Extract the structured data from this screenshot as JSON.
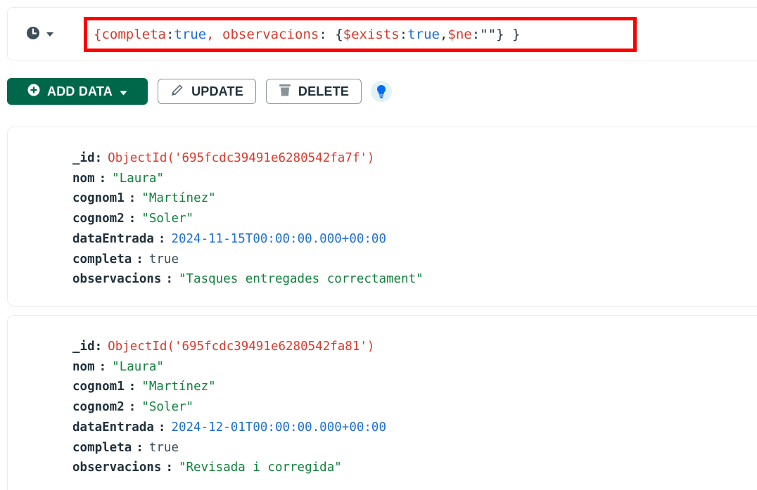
{
  "query": {
    "icon": "clock-icon",
    "text_parts": [
      {
        "t": "{completa",
        "c": "red"
      },
      {
        "t": ": ",
        "c": "dark"
      },
      {
        "t": "true",
        "c": "blue"
      },
      {
        "t": ", observacions",
        "c": "red"
      },
      {
        "t": ": { ",
        "c": "dark"
      },
      {
        "t": "$exists",
        "c": "red"
      },
      {
        "t": ": ",
        "c": "dark"
      },
      {
        "t": "true",
        "c": "blue"
      },
      {
        "t": ", ",
        "c": "dark"
      },
      {
        "t": "$ne",
        "c": "red"
      },
      {
        "t": ": ",
        "c": "dark"
      },
      {
        "t": "\"\"",
        "c": "dark"
      },
      {
        "t": "} }",
        "c": "dark"
      }
    ]
  },
  "toolbar": {
    "add_label": "ADD DATA",
    "update_label": "UPDATE",
    "delete_label": "DELETE"
  },
  "colors": {
    "accent_green": "#00684a",
    "highlight_border": "#ff0000",
    "object_id": "#d83b2d",
    "string": "#12813c",
    "date": "#1f6fd1"
  },
  "documents": [
    {
      "fields": [
        {
          "key": "_id",
          "value": "ObjectId('695fcdc39491e6280542fa7f')",
          "type": "oid"
        },
        {
          "key": "nom",
          "value": "\"Laura\"",
          "type": "str"
        },
        {
          "key": "cognom1",
          "value": "\"Martínez\"",
          "type": "str"
        },
        {
          "key": "cognom2",
          "value": "\"Soler\"",
          "type": "str"
        },
        {
          "key": "dataEntrada",
          "value": "2024-11-15T00:00:00.000+00:00",
          "type": "date"
        },
        {
          "key": "completa",
          "value": "true",
          "type": "bool"
        },
        {
          "key": "observacions",
          "value": "\"Tasques entregades correctament\"",
          "type": "str"
        }
      ]
    },
    {
      "fields": [
        {
          "key": "_id",
          "value": "ObjectId('695fcdc39491e6280542fa81')",
          "type": "oid"
        },
        {
          "key": "nom",
          "value": "\"Laura\"",
          "type": "str"
        },
        {
          "key": "cognom1",
          "value": "\"Martínez\"",
          "type": "str"
        },
        {
          "key": "cognom2",
          "value": "\"Soler\"",
          "type": "str"
        },
        {
          "key": "dataEntrada",
          "value": "2024-12-01T00:00:00.000+00:00",
          "type": "date"
        },
        {
          "key": "completa",
          "value": "true",
          "type": "bool"
        },
        {
          "key": "observacions",
          "value": "\"Revisada i corregida\"",
          "type": "str"
        }
      ]
    }
  ]
}
